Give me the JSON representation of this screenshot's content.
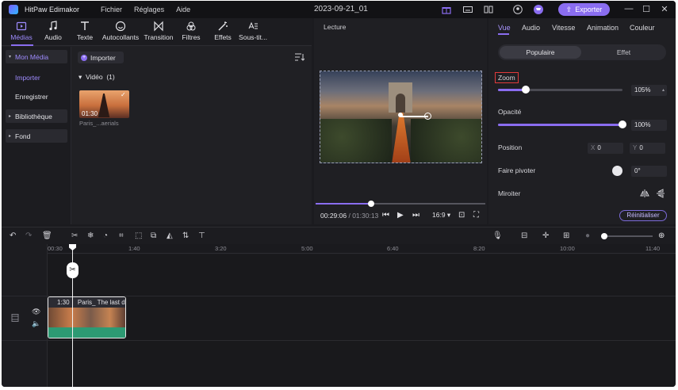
{
  "titlebar": {
    "app_name": "HitPaw Edimakor",
    "menu": [
      "Fichier",
      "Réglages",
      "Aide"
    ],
    "doc_title": "2023-09-21_01",
    "export_label": "Exporter"
  },
  "toolbar": {
    "tools": [
      "Médias",
      "Audio",
      "Texte",
      "Autocollants",
      "Transition",
      "Filtres",
      "Effets",
      "Sous-tit..."
    ],
    "active": "Médias"
  },
  "sidebar": {
    "items": [
      "Mon Média",
      "Importer",
      "Enregistrer",
      "Bibliothèque",
      "Fond"
    ],
    "active": "Mon Média"
  },
  "media": {
    "import_label": "Importer",
    "section_label": "Vidéo",
    "section_count": "(1)",
    "clip": {
      "duration": "01:30",
      "name": "Paris_...aerials"
    }
  },
  "preview": {
    "title": "Lecture",
    "current_time": "00:29:06",
    "total_time": "/ 01:30:13",
    "progress": 0.33,
    "ratio": "16:9"
  },
  "props": {
    "tabs": [
      "Vue",
      "Audio",
      "Vitesse",
      "Animation",
      "Couleur"
    ],
    "active_tab": "Vue",
    "segments": [
      "Populaire",
      "Effet"
    ],
    "zoom_label": "Zoom",
    "zoom_value": "105%",
    "zoom_level": 0.22,
    "opacity_label": "Opacité",
    "opacity_value": "100%",
    "opacity_level": 1.0,
    "position_label": "Position",
    "pos_x_key": "X",
    "pos_x": "0",
    "pos_y_key": "Y",
    "pos_y": "0",
    "rotate_label": "Faire pivoter",
    "rotate_value": "0°",
    "mirror_label": "Miroiter",
    "reset_label": "Réinitialiser"
  },
  "timeline": {
    "ruler": [
      "00:30",
      "1:40",
      "3:20",
      "5:00",
      "6:40",
      "8:20",
      "10:00",
      "11:40"
    ],
    "clip_duration": "1:30",
    "clip_name": "Paris_ The last d"
  },
  "colors": {
    "accent": "#8a6df0",
    "background": "#1b1b1f",
    "audio_wave": "#2d9a73",
    "highlight_box": "#e23b3b"
  }
}
